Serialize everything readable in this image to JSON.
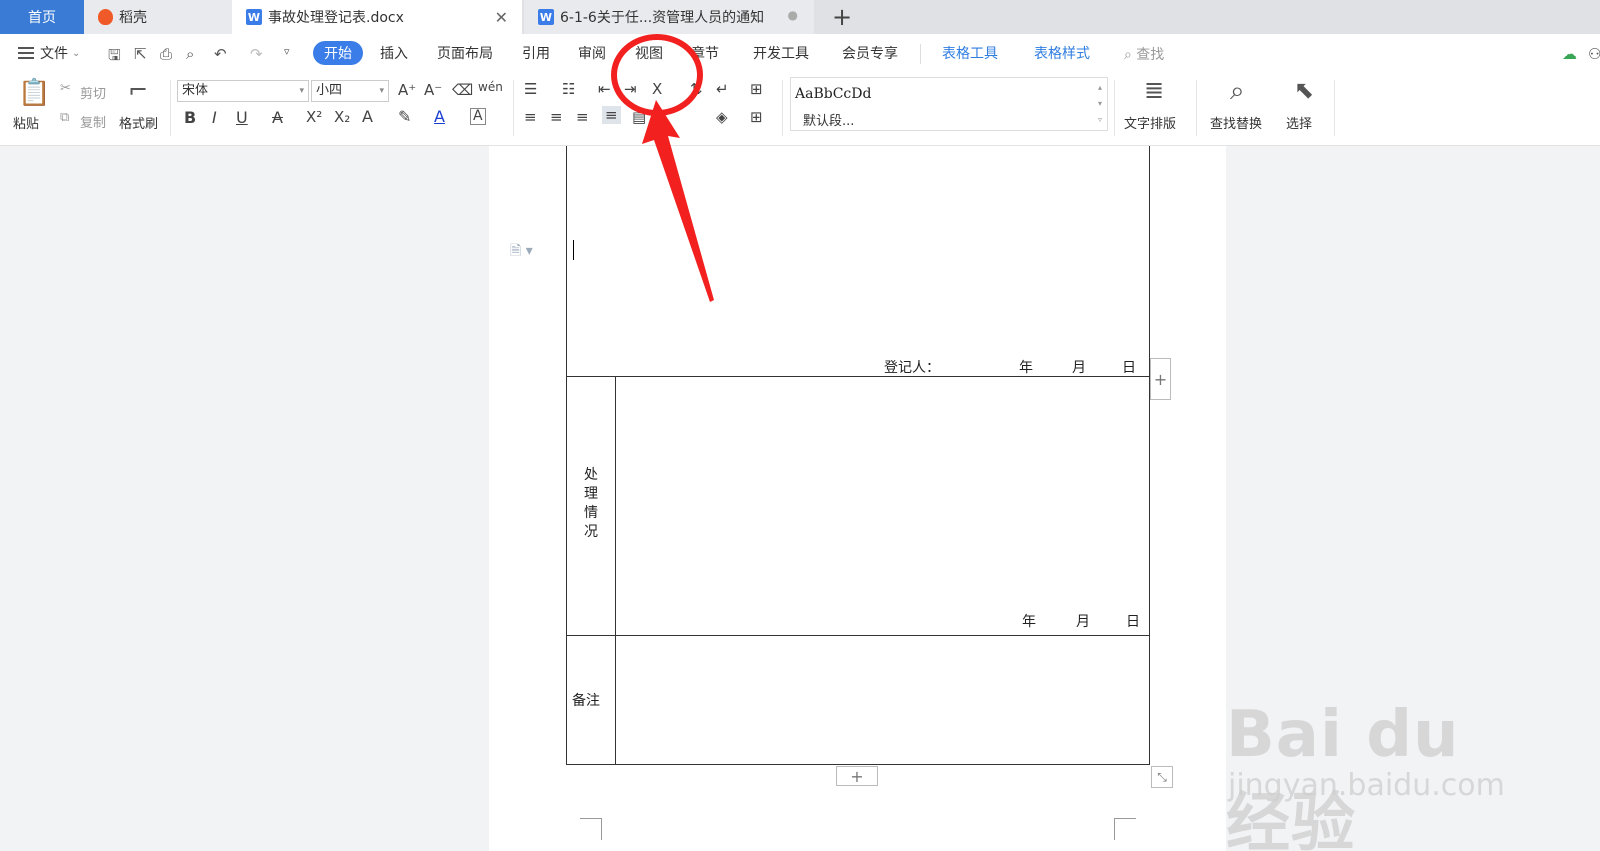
{
  "tabs": {
    "home": "首页",
    "daoke": "稻壳",
    "doc1": "事故处理登记表.docx",
    "doc2": "6-1-6关于任...资管理人员的通知",
    "plus": "+"
  },
  "menu": {
    "file": "文件",
    "start": "开始",
    "insert": "插入",
    "layout": "页面布局",
    "ref": "引用",
    "review": "审阅",
    "view": "视图",
    "section": "章节",
    "dev": "开发工具",
    "member": "会员专享",
    "table_tools": "表格工具",
    "table_style": "表格样式",
    "search": "查找"
  },
  "ribbon": {
    "paste": "粘贴",
    "cut": "剪切",
    "copy": "复制",
    "format_painter": "格式刷",
    "font": "宋体",
    "size": "小四",
    "style_sample": "AaBbCcDd",
    "style_name": "默认段...",
    "text_layout": "文字排版",
    "find_replace": "查找替换",
    "select": "选择"
  },
  "table": {
    "registrar": "登记人：",
    "year": "年",
    "month": "月",
    "day": "日",
    "handling": "处理情况",
    "remark": "备注"
  },
  "watermark": {
    "brand": "Bai du 经验",
    "url": "jingyan.baidu.com"
  },
  "colors": {
    "accent": "#3b7de8",
    "annotation": "#f2201f"
  }
}
